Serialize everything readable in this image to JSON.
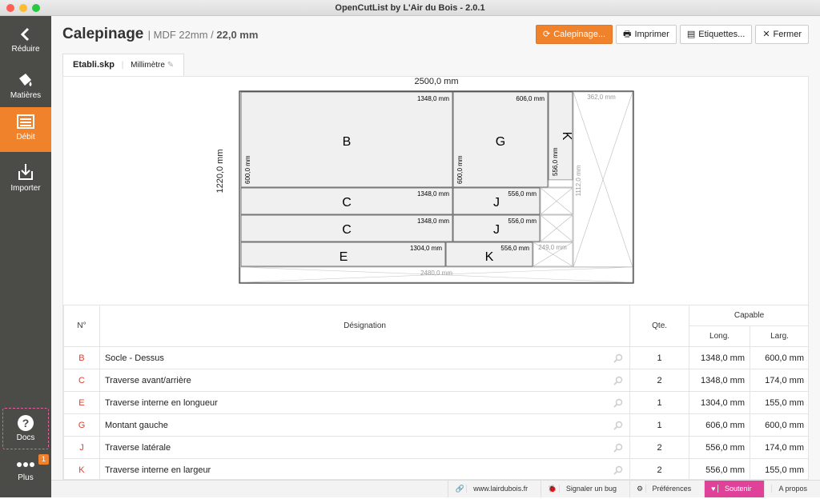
{
  "window": {
    "title": "OpenCutList by L'Air du Bois - 2.0.1"
  },
  "sidebar": {
    "items": [
      {
        "label": "Réduire",
        "icon": "chevron-left-icon"
      },
      {
        "label": "Matières",
        "icon": "paint-bucket-icon"
      },
      {
        "label": "Débit",
        "icon": "list-icon"
      },
      {
        "label": "Importer",
        "icon": "import-icon"
      }
    ],
    "docs_label": "Docs",
    "more_label": "Plus",
    "more_badge": "1"
  },
  "header": {
    "title": "Calepinage",
    "material": "| MDF 22mm /",
    "thickness": "22,0 mm"
  },
  "toolbar": {
    "calepinage": "Calepinage...",
    "print": "Imprimer",
    "labels": "Etiquettes...",
    "close": "Fermer"
  },
  "tab": {
    "file": "Etabli.skp",
    "unit": "Millimètre"
  },
  "plan": {
    "width_label": "2500,0 mm",
    "height_label": "1220,0 mm",
    "parts": [
      {
        "letter": "B",
        "len": "1348,0 mm",
        "wid": "600,0 mm"
      },
      {
        "letter": "G",
        "len": "606,0 mm",
        "wid": "600,0 mm"
      },
      {
        "letter": "K",
        "len": "556,0 mm"
      },
      {
        "letter": "C",
        "len": "1348,0 mm"
      },
      {
        "letter": "J",
        "len": "556,0 mm"
      },
      {
        "letter": "C",
        "len": "1348,0 mm"
      },
      {
        "letter": "J",
        "len": "556,0 mm"
      },
      {
        "letter": "E",
        "len": "1304,0 mm"
      },
      {
        "letter": "K",
        "len": "556,0 mm"
      }
    ],
    "waste": [
      {
        "label": "362,0 mm"
      },
      {
        "label": "1112,0 mm"
      },
      {
        "label": "249,0 mm"
      },
      {
        "label": "2480,0 mm"
      }
    ]
  },
  "table": {
    "headers": {
      "num": "N°",
      "desig": "Désignation",
      "qty": "Qte.",
      "capable": "Capable",
      "long": "Long.",
      "larg": "Larg."
    },
    "rows": [
      {
        "num": "B",
        "desig": "Socle - Dessus",
        "qty": "1",
        "long": "1348,0 mm",
        "larg": "600,0 mm"
      },
      {
        "num": "C",
        "desig": "Traverse avant/arrière",
        "qty": "2",
        "long": "1348,0 mm",
        "larg": "174,0 mm"
      },
      {
        "num": "E",
        "desig": "Traverse interne en longueur",
        "qty": "1",
        "long": "1304,0 mm",
        "larg": "155,0 mm"
      },
      {
        "num": "G",
        "desig": "Montant gauche",
        "qty": "1",
        "long": "606,0 mm",
        "larg": "600,0 mm"
      },
      {
        "num": "J",
        "desig": "Traverse latérale",
        "qty": "2",
        "long": "556,0 mm",
        "larg": "174,0 mm"
      },
      {
        "num": "K",
        "desig": "Traverse interne en largeur",
        "qty": "2",
        "long": "556,0 mm",
        "larg": "155,0 mm"
      }
    ]
  },
  "footer": {
    "site": "www.lairdubois.fr",
    "bug": "Signaler un bug",
    "prefs": "Préférences",
    "support": "Soutenir",
    "about": "A propos"
  },
  "colors": {
    "accent": "#f0822c",
    "sidebar": "#4b4b48",
    "support": "#e0429a",
    "num": "#e03c2c"
  }
}
